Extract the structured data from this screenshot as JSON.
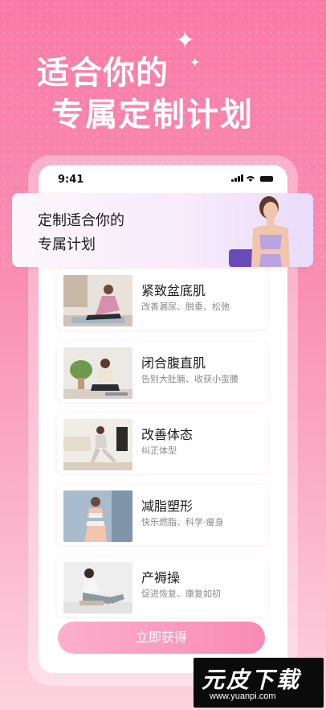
{
  "hero": {
    "line1": "适合你的",
    "line2": "专属定制计划"
  },
  "phone": {
    "time": "9:41"
  },
  "banner": {
    "line1": "定制适合你的",
    "line2": "专属计划"
  },
  "plans": [
    {
      "title": "紧致盆底肌",
      "subtitle": "改善漏尿、脱垂、松弛"
    },
    {
      "title": "闭合腹直肌",
      "subtitle": "告别大肚腩、收获小蛮腰"
    },
    {
      "title": "改善体态",
      "subtitle": "纠正体型"
    },
    {
      "title": "减脂塑形",
      "subtitle": "快乐燃脂、科学·瘦身"
    },
    {
      "title": "产褥操",
      "subtitle": "促进恢复、康复如初"
    }
  ],
  "cta": {
    "label": "立即获得"
  },
  "watermark": {
    "main": "元皮下载",
    "url": "www.yuanpi.com"
  },
  "colors": {
    "background_top": "#f97aa6",
    "background_bottom": "#fdd3e0",
    "accent": "#f98ab3"
  }
}
